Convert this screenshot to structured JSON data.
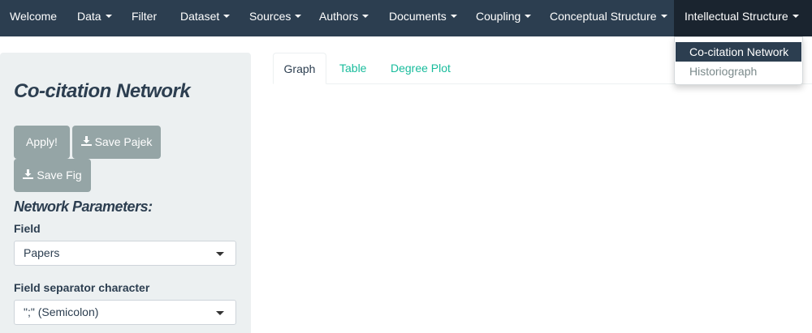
{
  "navbar": {
    "items": [
      {
        "label": "Welcome",
        "has_caret": false
      },
      {
        "label": "Data",
        "has_caret": true
      },
      {
        "label": "Filter",
        "has_caret": false
      },
      {
        "label": "Dataset",
        "has_caret": true
      },
      {
        "label": "Sources",
        "has_caret": true
      },
      {
        "label": "Authors",
        "has_caret": true
      },
      {
        "label": "Documents",
        "has_caret": true
      },
      {
        "label": "Coupling",
        "has_caret": true
      },
      {
        "label": "Conceptual Structure",
        "has_caret": true
      },
      {
        "label": "Intellectual Structure",
        "has_caret": true,
        "active": true
      }
    ]
  },
  "dropdown": {
    "items": [
      {
        "label": "Co-citation Network",
        "selected": true
      },
      {
        "label": "Historiograph",
        "selected": false
      }
    ]
  },
  "sidebar": {
    "title": "Co-citation Network",
    "buttons": {
      "apply": "Apply!",
      "save_pajek": "Save Pajek",
      "save_fig": "Save Fig"
    },
    "section_label": "Network Parameters:",
    "field": {
      "label": "Field",
      "value": "Papers"
    },
    "separator": {
      "label": "Field separator character",
      "value": "\";\" (Semicolon)"
    }
  },
  "tabs": [
    {
      "label": "Graph",
      "active": true
    },
    {
      "label": "Table",
      "active": false
    },
    {
      "label": "Degree Plot",
      "active": false
    }
  ],
  "colors": {
    "navbar_bg": "#2c3e50",
    "navbar_active_bg": "#1a242f",
    "sidebar_bg": "#ecf0f1",
    "button_bg": "#95a5a6",
    "link": "#18bc9c",
    "text": "#2c3e50"
  },
  "icons": {
    "download": "download-icon",
    "caret": "caret-down-icon"
  }
}
